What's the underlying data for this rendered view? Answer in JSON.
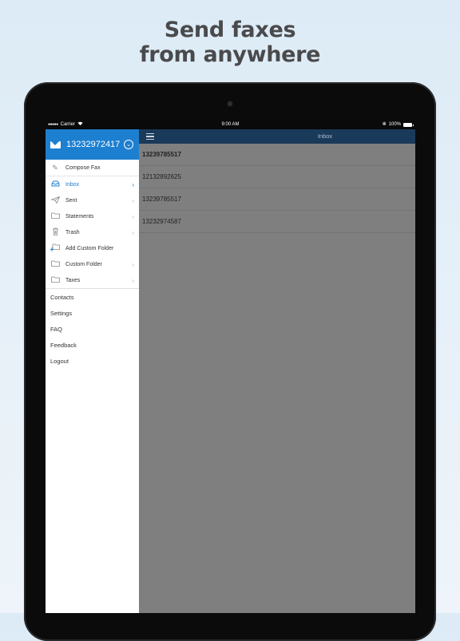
{
  "headline": {
    "line1": "Send faxes",
    "line2": "from anywhere"
  },
  "status_bar": {
    "dots": "●●●●●",
    "carrier": "Carrier",
    "wifi": "wifi",
    "time": "9:00 AM",
    "bluetooth": "✻",
    "battery_pct": "100%"
  },
  "account": {
    "number": "13232972417"
  },
  "menu": {
    "compose": "Compose Fax",
    "folders": [
      {
        "label": "Inbox",
        "icon": "inbox-icon",
        "active": true
      },
      {
        "label": "Sent",
        "icon": "paper-plane-icon"
      },
      {
        "label": "Statements",
        "icon": "folder-icon"
      },
      {
        "label": "Trash",
        "icon": "trash-icon"
      },
      {
        "label": "Add Custom Folder",
        "icon": "add-folder-icon"
      },
      {
        "label": "Custom Folder",
        "icon": "folder-icon"
      },
      {
        "label": "Taxes",
        "icon": "folder-icon"
      }
    ],
    "links": [
      "Contacts",
      "Settings",
      "FAQ",
      "Feedback",
      "Logout"
    ]
  },
  "main": {
    "title": "Inbox",
    "faxes": [
      "13239785517",
      "12132892625",
      "13239785517",
      "13232974587"
    ]
  },
  "colors": {
    "accent": "#1d7fd0",
    "navbar": "#1a3a5a",
    "overlay": "#7f7f7f"
  }
}
